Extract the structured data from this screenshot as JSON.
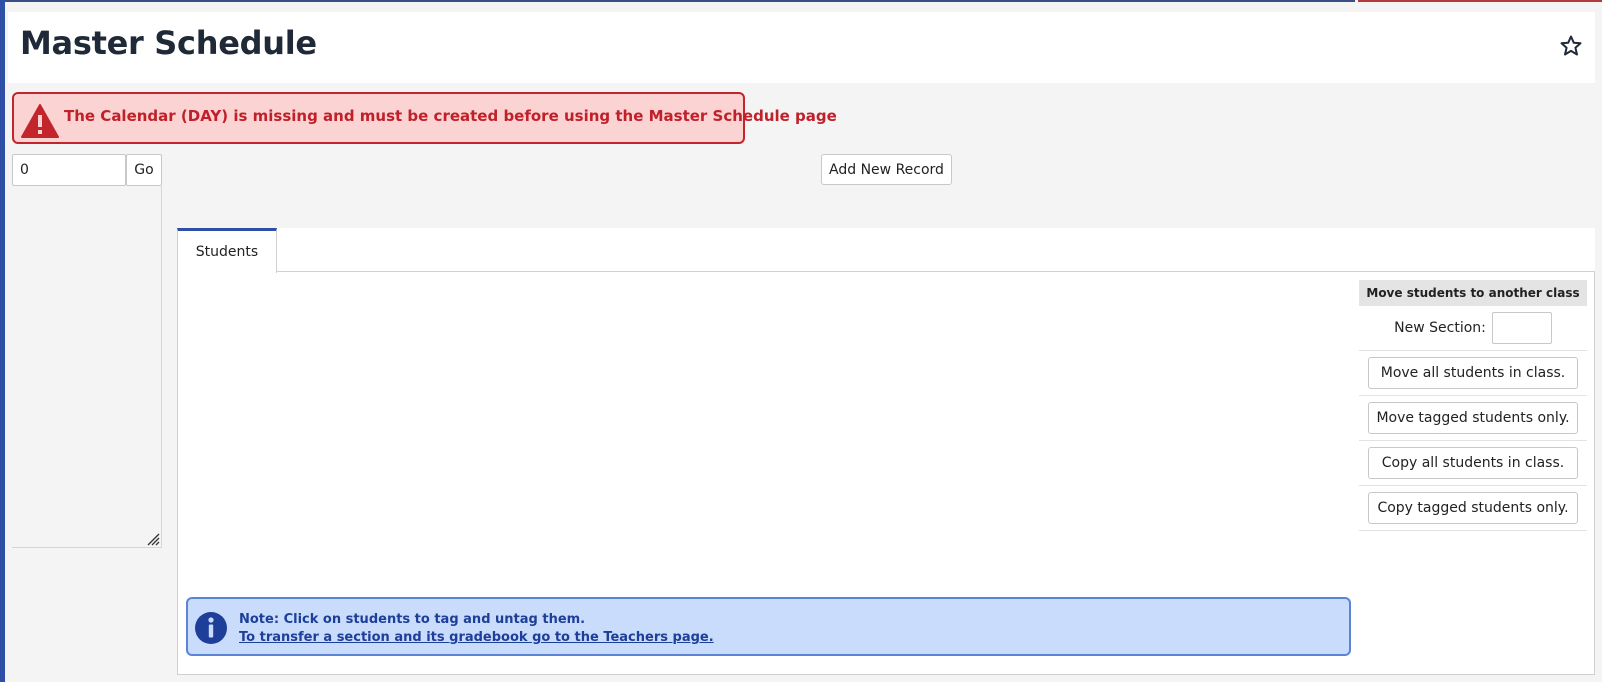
{
  "header": {
    "title": "Master Schedule",
    "favorite_icon": "star-icon"
  },
  "alert": {
    "icon": "warning-triangle-icon",
    "message": "The Calendar (DAY) is missing and must be created before using the Master Schedule page"
  },
  "record_nav": {
    "input_value": "0",
    "go_label": "Go"
  },
  "toolbar": {
    "add_record_label": "Add New Record"
  },
  "tabs": [
    {
      "label": "Students",
      "active": true
    }
  ],
  "move_panel": {
    "header": "Move students to another class",
    "new_section_label": "New Section:",
    "new_section_value": "",
    "buttons": [
      "Move all students in class.",
      "Move tagged students only.",
      "Copy all students in class.",
      "Copy tagged students only."
    ]
  },
  "note": {
    "icon": "info-icon",
    "text": "Note: Click on students to tag and untag them.",
    "link_text": "To transfer a section and its gradebook go to the Teachers page."
  },
  "colors": {
    "accent": "#2f4fa6",
    "alert_bg": "#fbd3d3",
    "alert_border": "#c2252b",
    "alert_text": "#c0202a",
    "note_bg": "#c9dcfb",
    "note_border": "#5b83d6",
    "note_text": "#1d3f99"
  }
}
